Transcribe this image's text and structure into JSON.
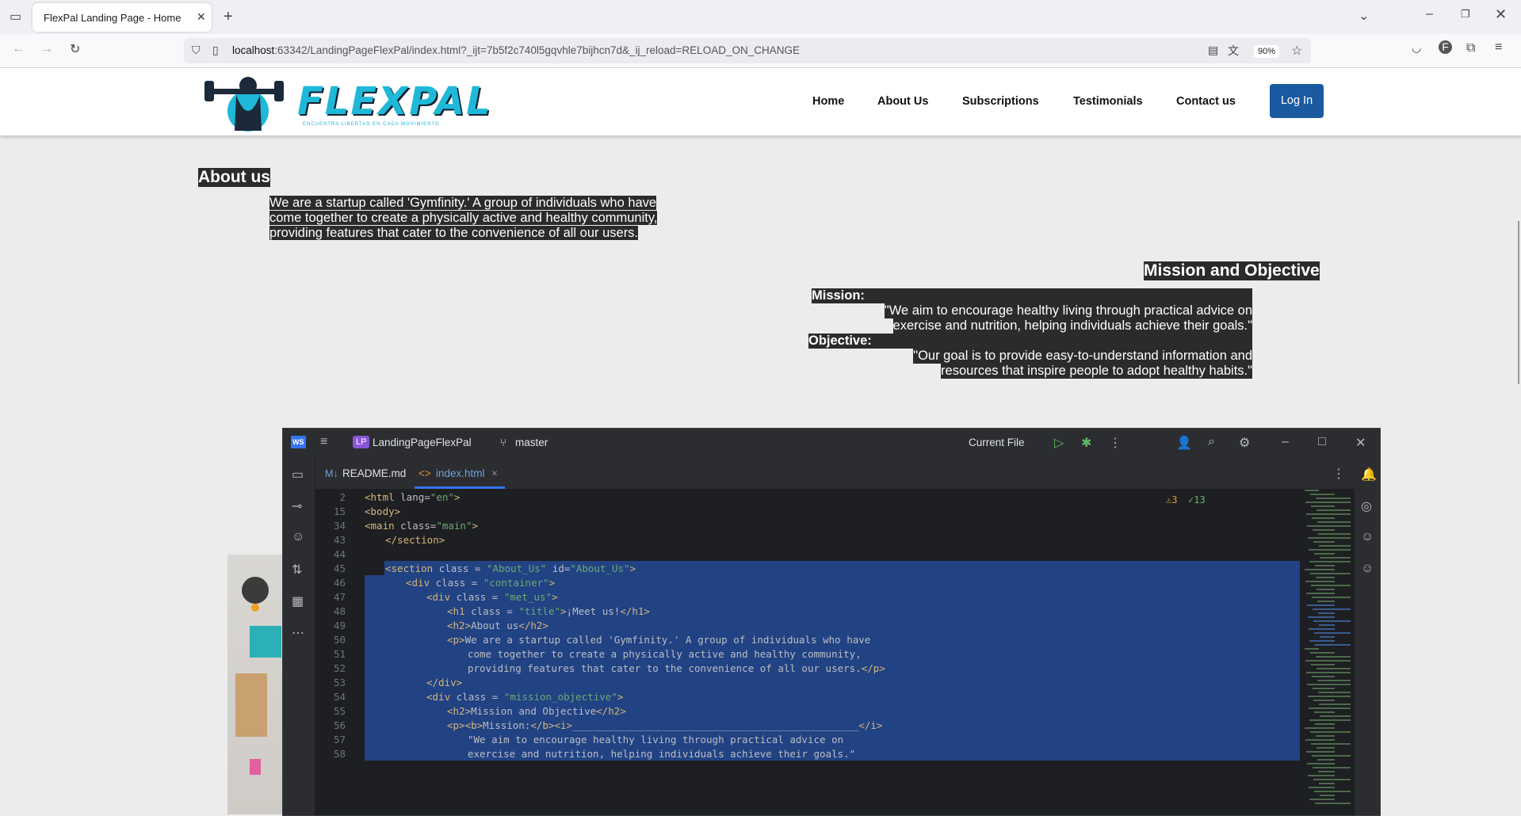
{
  "browser": {
    "tab_title": "FlexPal Landing Page - Home",
    "url_host": "localhost",
    "url_rest": ":63342/LandingPageFlexPal/index.html?_ijt=7b5f2c740l5gqvhle7bijhcn7d&_ij_reload=RELOAD_ON_CHANGE",
    "zoom": "90%"
  },
  "site": {
    "logo_text": "FLEXPAL",
    "logo_tagline": "ENCUENTRA LIBERTAD EN CADA MOVIMIENTO",
    "nav": [
      "Home",
      "About Us",
      "Subscriptions",
      "Testimonials",
      "Contact us"
    ],
    "login_label": "Log In"
  },
  "about": {
    "heading": "About us",
    "lines": [
      "We are a startup called 'Gymfinity.' A group of individuals who have",
      "come together to create a physically active and healthy community,",
      "providing features that cater to the convenience of all our users."
    ]
  },
  "mission": {
    "heading": "Mission and Objective",
    "mission_label": "Mission:",
    "mission_lines": [
      "\"We aim to encourage healthy living through practical advice on",
      "exercise and nutrition, helping individuals achieve their goals.\""
    ],
    "objective_label": "Objective:",
    "objective_lines": [
      "\"Our goal is to provide easy-to-understand information and",
      "resources that inspire people to adopt healthy habits.\""
    ]
  },
  "ide": {
    "project_badge": "LP",
    "project": "LandingPageFlexPal",
    "branch": "master",
    "run_config": "Current File",
    "tabs": [
      "README.md",
      "index.html"
    ],
    "warnings": "3",
    "checks": "13",
    "lines": [
      {
        "n": "2",
        "html": "<span class='tag'>&lt;html </span><span class='attr'>lang=</span><span class='str'>\"en\"</span><span class='tag'>&gt;</span>",
        "indent": 0
      },
      {
        "n": "15",
        "html": "<span class='tag'>&lt;body&gt;</span>",
        "indent": 0
      },
      {
        "n": "34",
        "html": "<span class='tag'>&lt;main </span><span class='attr'>class=</span><span class='str'>\"main\"</span><span class='tag'>&gt;</span>",
        "indent": 0
      },
      {
        "n": "43",
        "html": "<span class='tag'>&lt;/section&gt;</span>",
        "indent": 1
      },
      {
        "n": "44",
        "html": "",
        "indent": 0
      },
      {
        "n": "45",
        "html": "<span class='tag'>&lt;section </span><span class='attr'>class = </span><span class='str'>\"About_Us\"</span><span class='attr'> id=</span><span class='str'>\"About_Us\"</span><span class='tag'>&gt;</span>",
        "indent": 1
      },
      {
        "n": "46",
        "html": "<span class='tag'>&lt;div </span><span class='attr'>class = </span><span class='str'>\"container\"</span><span class='tag'>&gt;</span>",
        "indent": 2
      },
      {
        "n": "47",
        "html": "<span class='tag'>&lt;div </span><span class='attr'>class = </span><span class='str'>\"met_us\"</span><span class='tag'>&gt;</span>",
        "indent": 3
      },
      {
        "n": "48",
        "html": "<span class='tag'>&lt;h1 </span><span class='attr'>class = </span><span class='str'>\"title\"</span><span class='tag'>&gt;</span><span class='tx'>¡Meet us!</span><span class='tag'>&lt;/h1&gt;</span>",
        "indent": 4
      },
      {
        "n": "49",
        "html": "<span class='tag'>&lt;h2&gt;</span><span class='tx'>About us</span><span class='tag'>&lt;/h2&gt;</span>",
        "indent": 4
      },
      {
        "n": "50",
        "html": "<span class='tag'>&lt;p&gt;</span><span class='tx'>We are a startup called 'Gymfinity.' A group of individuals who have</span>",
        "indent": 4
      },
      {
        "n": "51",
        "html": "<span class='tx'>come together to create a physically active and healthy community,</span>",
        "indent": 5
      },
      {
        "n": "52",
        "html": "<span class='tx'>providing features that cater to the convenience of all our users.</span><span class='tag'>&lt;/p&gt;</span>",
        "indent": 5
      },
      {
        "n": "53",
        "html": "<span class='tag'>&lt;/div&gt;</span>",
        "indent": 3
      },
      {
        "n": "54",
        "html": "<span class='tag'>&lt;div </span><span class='attr'>class = </span><span class='str'>\"mission_objective\"</span><span class='tag'>&gt;</span>",
        "indent": 3
      },
      {
        "n": "55",
        "html": "<span class='tag'>&lt;h2&gt;</span><span class='tx'>Mission and Objective</span><span class='tag'>&lt;/h2&gt;</span>",
        "indent": 4
      },
      {
        "n": "56",
        "html": "<span class='tag'>&lt;p&gt;&lt;b&gt;</span><span class='tx'>Mission:</span><span class='tag'>&lt;/b&gt;&lt;i&gt;</span><span class='tx'>________________________________________________</span><span class='tag'>&lt;/i&gt;</span>",
        "indent": 4
      },
      {
        "n": "57",
        "html": "<span class='tx'>\"We aim to encourage healthy living through practical advice on</span>",
        "indent": 5
      },
      {
        "n": "58",
        "html": "<span class='tx'>exercise and nutrition, helping individuals achieve their goals.\"</span>",
        "indent": 5
      }
    ]
  }
}
